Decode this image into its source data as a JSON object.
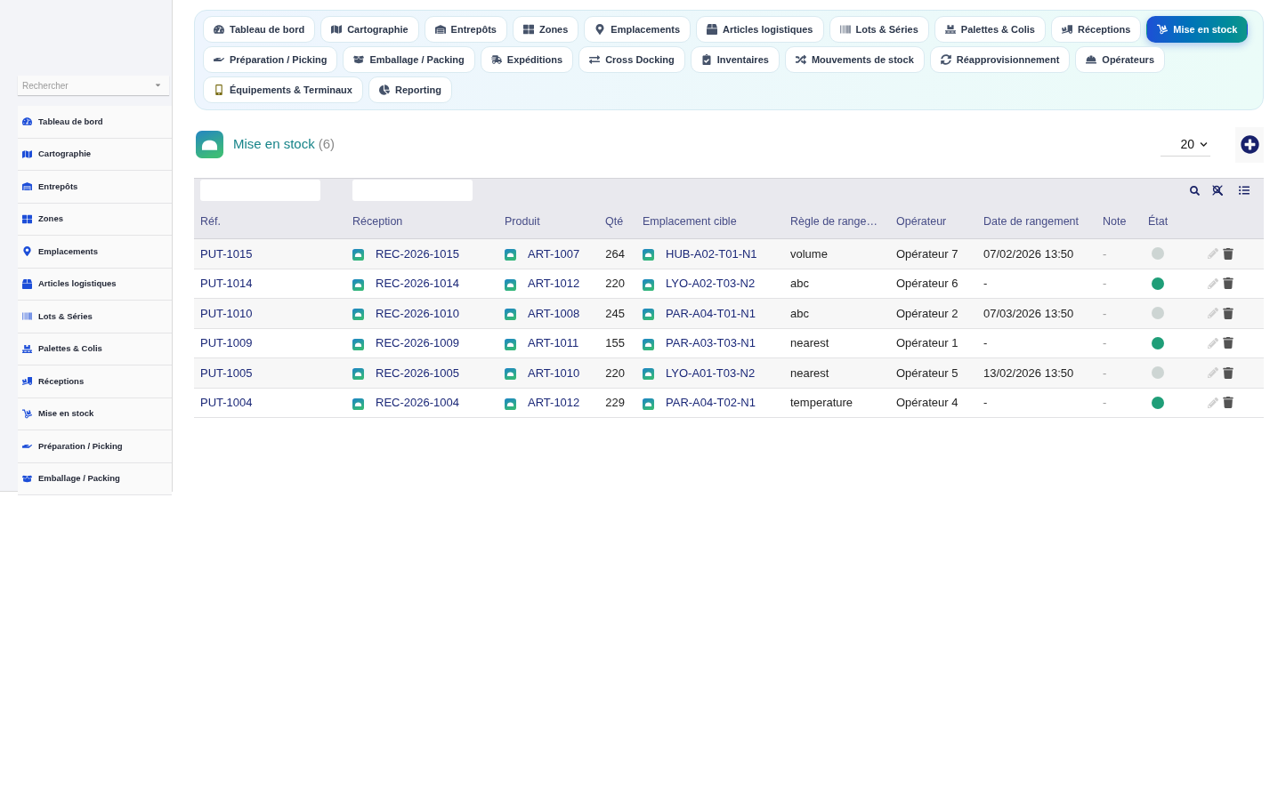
{
  "sidebar": {
    "search": {
      "placeholder": "Rechercher"
    },
    "items": [
      {
        "label": "Tableau de bord"
      },
      {
        "label": "Cartographie"
      },
      {
        "label": "Entrepôts"
      },
      {
        "label": "Zones"
      },
      {
        "label": "Emplacements"
      },
      {
        "label": "Articles logistiques"
      },
      {
        "label": "Lots & Séries"
      },
      {
        "label": "Palettes & Colis"
      },
      {
        "label": "Réceptions"
      },
      {
        "label": "Mise en stock"
      },
      {
        "label": "Préparation / Picking"
      },
      {
        "label": "Emballage / Packing"
      }
    ]
  },
  "nav": {
    "tabs": [
      {
        "label": "Tableau de bord",
        "selected": false
      },
      {
        "label": "Cartographie",
        "selected": false
      },
      {
        "label": "Entrepôts",
        "selected": false
      },
      {
        "label": "Zones",
        "selected": false
      },
      {
        "label": "Emplacements",
        "selected": false
      },
      {
        "label": "Articles logistiques",
        "selected": false
      },
      {
        "label": "Lots & Séries",
        "selected": false
      },
      {
        "label": "Palettes & Colis",
        "selected": false
      },
      {
        "label": "Réceptions",
        "selected": false
      },
      {
        "label": "Mise en stock",
        "selected": true
      },
      {
        "label": "Préparation / Picking",
        "selected": false
      },
      {
        "label": "Emballage / Packing",
        "selected": false
      },
      {
        "label": "Expéditions",
        "selected": false
      },
      {
        "label": "Cross Docking",
        "selected": false
      },
      {
        "label": "Inventaires",
        "selected": false
      },
      {
        "label": "Mouvements de stock",
        "selected": false
      },
      {
        "label": "Réapprovisionnement",
        "selected": false
      },
      {
        "label": "Opérateurs",
        "selected": false
      },
      {
        "label": "Équipements & Terminaux",
        "selected": false
      },
      {
        "label": "Reporting",
        "selected": false
      }
    ]
  },
  "header": {
    "title": "Mise en stock",
    "count": "(6)",
    "page_size": "20"
  },
  "table": {
    "columns": [
      "Réf.",
      "Réception",
      "Produit",
      "Qté",
      "Emplacement cible",
      "Règle de range…",
      "Opérateur",
      "Date de rangement",
      "Note",
      "État"
    ],
    "rows": [
      {
        "ref": "PUT-1015",
        "reception": "REC-2026-1015",
        "product": "ART-1007",
        "qty": "264",
        "location": "HUB-A02-T01-N1",
        "rule": "volume",
        "operator": "Opérateur 7",
        "date": "07/02/2026 13:50",
        "note": "-",
        "color": "#cdd5d3"
      },
      {
        "ref": "PUT-1014",
        "reception": "REC-2026-1014",
        "product": "ART-1012",
        "qty": "220",
        "location": "LYO-A02-T03-N2",
        "rule": "abc",
        "operator": "Opérateur 6",
        "date": "-",
        "note": "-",
        "color": "#1f9e78"
      },
      {
        "ref": "PUT-1010",
        "reception": "REC-2026-1010",
        "product": "ART-1008",
        "qty": "245",
        "location": "PAR-A04-T01-N1",
        "rule": "abc",
        "operator": "Opérateur 2",
        "date": "07/03/2026 13:50",
        "note": "-",
        "color": "#cdd5d3"
      },
      {
        "ref": "PUT-1009",
        "reception": "REC-2026-1009",
        "product": "ART-1011",
        "qty": "155",
        "location": "PAR-A03-T03-N1",
        "rule": "nearest",
        "operator": "Opérateur 1",
        "date": "-",
        "note": "-",
        "color": "#1f9e78"
      },
      {
        "ref": "PUT-1005",
        "reception": "REC-2026-1005",
        "product": "ART-1010",
        "qty": "220",
        "location": "LYO-A01-T03-N2",
        "rule": "nearest",
        "operator": "Opérateur 5",
        "date": "13/02/2026 13:50",
        "note": "-",
        "color": "#cdd5d3"
      },
      {
        "ref": "PUT-1004",
        "reception": "REC-2026-1004",
        "product": "ART-1012",
        "qty": "229",
        "location": "PAR-A04-T02-N1",
        "rule": "temperature",
        "operator": "Opérateur 4",
        "date": "-",
        "note": "-",
        "color": "#1f9e78"
      }
    ]
  }
}
